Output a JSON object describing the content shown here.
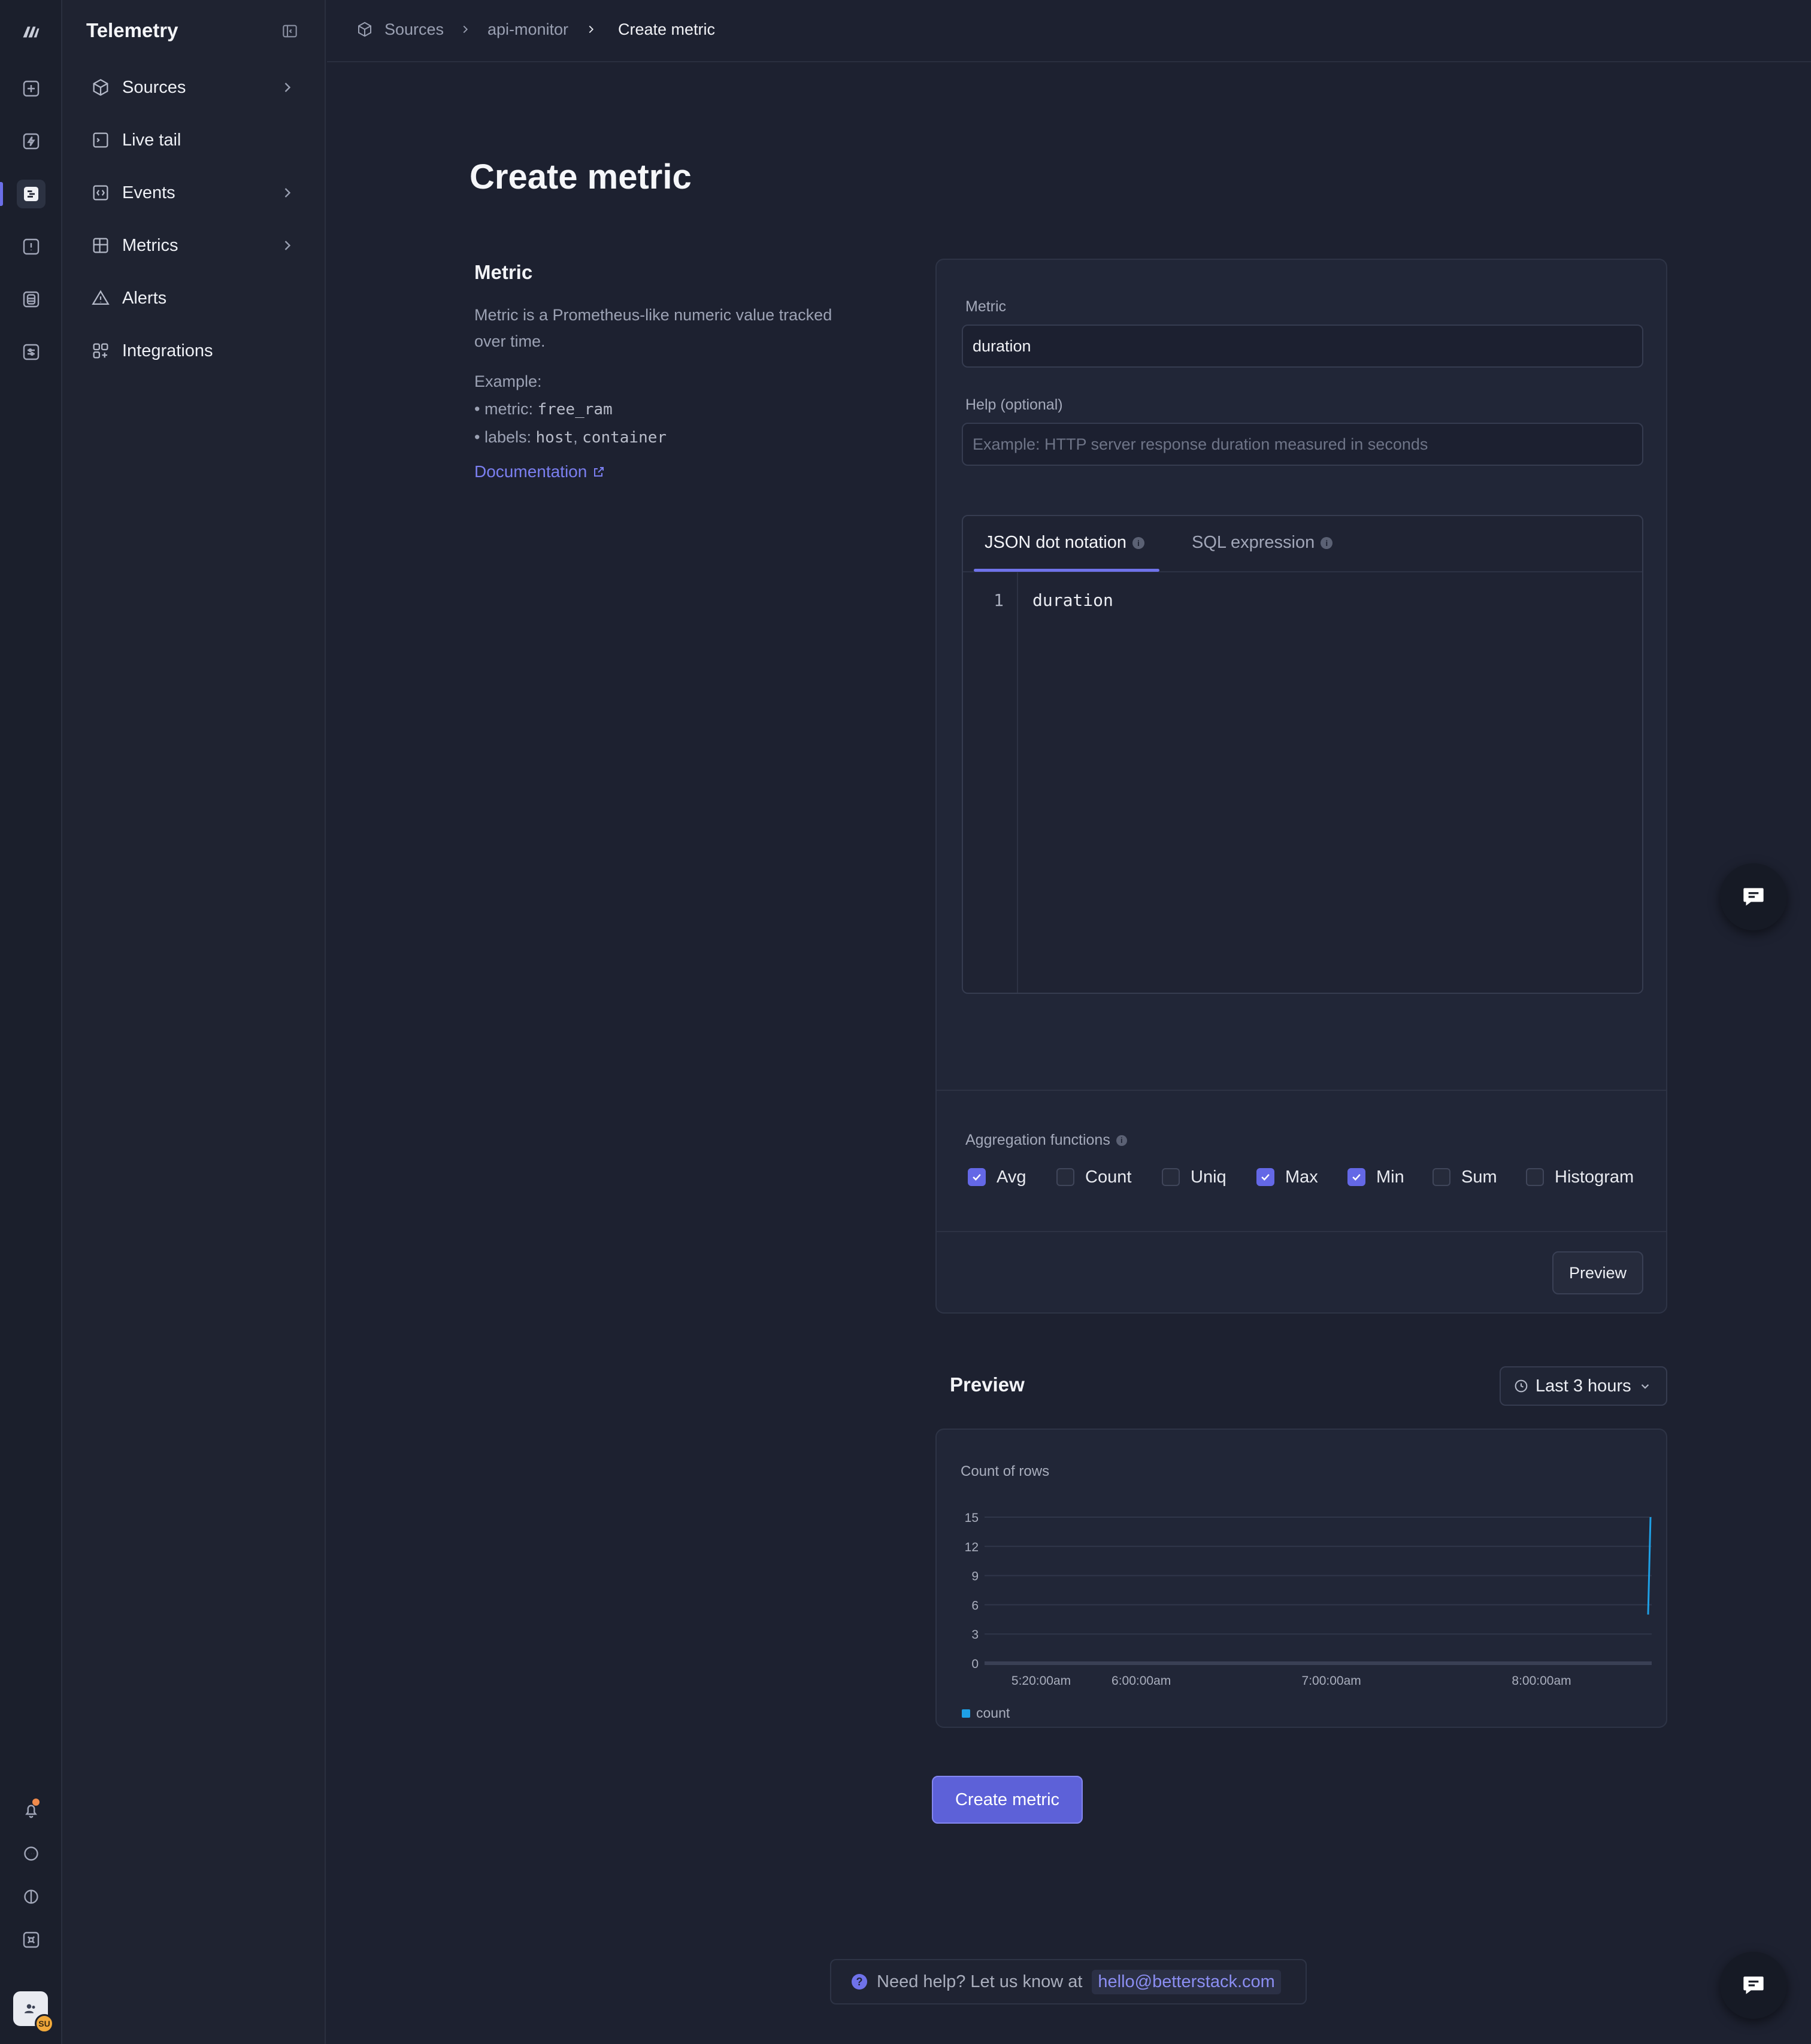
{
  "sidebar": {
    "title": "Telemetry",
    "items": [
      {
        "label": "Sources",
        "icon": "cube-icon",
        "has_chevron": true
      },
      {
        "label": "Live tail",
        "icon": "terminal-icon",
        "has_chevron": false
      },
      {
        "label": "Events",
        "icon": "code-brackets-icon",
        "has_chevron": true
      },
      {
        "label": "Metrics",
        "icon": "grid-icon",
        "has_chevron": true
      },
      {
        "label": "Alerts",
        "icon": "warning-icon",
        "has_chevron": false
      },
      {
        "label": "Integrations",
        "icon": "puzzle-icon",
        "has_chevron": false
      }
    ]
  },
  "breadcrumb": {
    "items": [
      "Sources",
      "api-monitor",
      "Create metric"
    ]
  },
  "page": {
    "title": "Create metric"
  },
  "info": {
    "section_title": "Metric",
    "description": "Metric is a Prometheus-like numeric value tracked over time.",
    "example_heading": "Example:",
    "example_metric_prefix": "• metric: ",
    "example_metric_value": "free_ram",
    "example_labels_prefix": "• labels: ",
    "example_label_1": "host",
    "example_label_sep": ", ",
    "example_label_2": "container",
    "doc_link": "Documentation"
  },
  "form": {
    "metric_label": "Metric",
    "metric_value": "duration",
    "help_label": "Help (optional)",
    "help_placeholder": "Example: HTTP server response duration measured in seconds",
    "tabs": [
      {
        "label": "JSON dot notation",
        "active": true
      },
      {
        "label": "SQL expression",
        "active": false
      }
    ],
    "editor": {
      "line_number": "1",
      "code": "duration"
    },
    "aggregation_label": "Aggregation functions",
    "aggregations": [
      {
        "label": "Avg",
        "checked": true
      },
      {
        "label": "Count",
        "checked": false
      },
      {
        "label": "Uniq",
        "checked": false
      },
      {
        "label": "Max",
        "checked": true
      },
      {
        "label": "Min",
        "checked": true
      },
      {
        "label": "Sum",
        "checked": false
      },
      {
        "label": "Histogram",
        "checked": false
      }
    ],
    "preview_button": "Preview"
  },
  "preview": {
    "title": "Preview",
    "range_label": "Last 3 hours"
  },
  "chart_data": {
    "type": "line",
    "title": "Count of rows",
    "x_tick_labels": [
      "5:20:00am",
      "6:00:00am",
      "7:00:00am",
      "8:00:00am"
    ],
    "y_ticks": [
      0,
      3,
      6,
      9,
      12,
      15
    ],
    "ylim": [
      0,
      15
    ],
    "grid": true,
    "legend_position": "bottom-left",
    "series": [
      {
        "name": "count",
        "color": "#1ea0e6",
        "points": [
          {
            "x": "8:00:00am",
            "y": 5
          },
          {
            "x": "8:00:00am",
            "y": 15
          }
        ]
      }
    ]
  },
  "actions": {
    "create_button": "Create metric"
  },
  "help": {
    "text": "Need help? Let us know at",
    "email": "hello@betterstack.com"
  },
  "user": {
    "badge": "SU"
  },
  "colors": {
    "accent": "#6468e6",
    "series": "#1ea0e6",
    "notification": "#f08a4b"
  }
}
